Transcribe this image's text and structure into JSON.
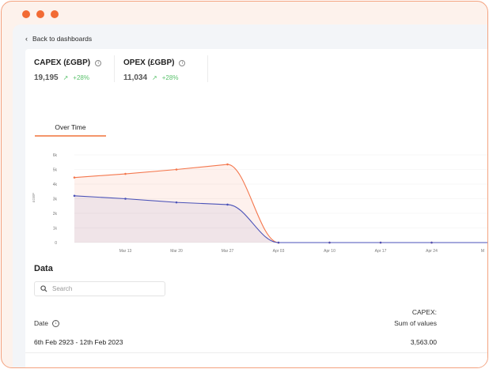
{
  "nav": {
    "back_label": "Back to dashboards"
  },
  "metrics": [
    {
      "title": "CAPEX (£GBP)",
      "value": "19,195",
      "change": "+28%"
    },
    {
      "title": "OPEX (£GBP)",
      "value": "11,034",
      "change": "+28%"
    }
  ],
  "tabs": [
    {
      "label": "Over Time",
      "active": true
    }
  ],
  "colors": {
    "accent": "#f26b34",
    "capex": "#f4774d",
    "opex": "#4a52b8",
    "trend_up": "#5bc26d"
  },
  "chart_data": {
    "type": "area",
    "ylabel": "£GBP",
    "y_ticks": [
      "0",
      "1k",
      "2k",
      "3k",
      "4k",
      "5k",
      "6k"
    ],
    "ylim": [
      0,
      6000
    ],
    "x_ticks": [
      "Mar 13",
      "Mar 20",
      "Mar 27",
      "Apr 03",
      "Apr 10",
      "Apr 17",
      "Apr 24",
      "M"
    ],
    "x": [
      "Mar 06",
      "Mar 13",
      "Mar 20",
      "Mar 27",
      "Apr 03",
      "Apr 10",
      "Apr 17",
      "Apr 24"
    ],
    "series": [
      {
        "name": "CAPEX (£GBP)",
        "values": [
          4450,
          4700,
          5000,
          5350,
          0,
          0,
          0,
          0
        ]
      },
      {
        "name": "OPEX (£GBP)",
        "values": [
          3200,
          3000,
          2750,
          2600,
          0,
          0,
          0,
          0
        ]
      }
    ],
    "grid": true,
    "legend": "bottom-right"
  },
  "data_section": {
    "title": "Data",
    "search_placeholder": "Search",
    "columns": {
      "date": "Date",
      "value_line1": "CAPEX:",
      "value_line2": "Sum of values"
    },
    "rows": [
      {
        "date": "6th Feb 2923 - 12th Feb 2023",
        "value": "3,563.00"
      }
    ]
  }
}
